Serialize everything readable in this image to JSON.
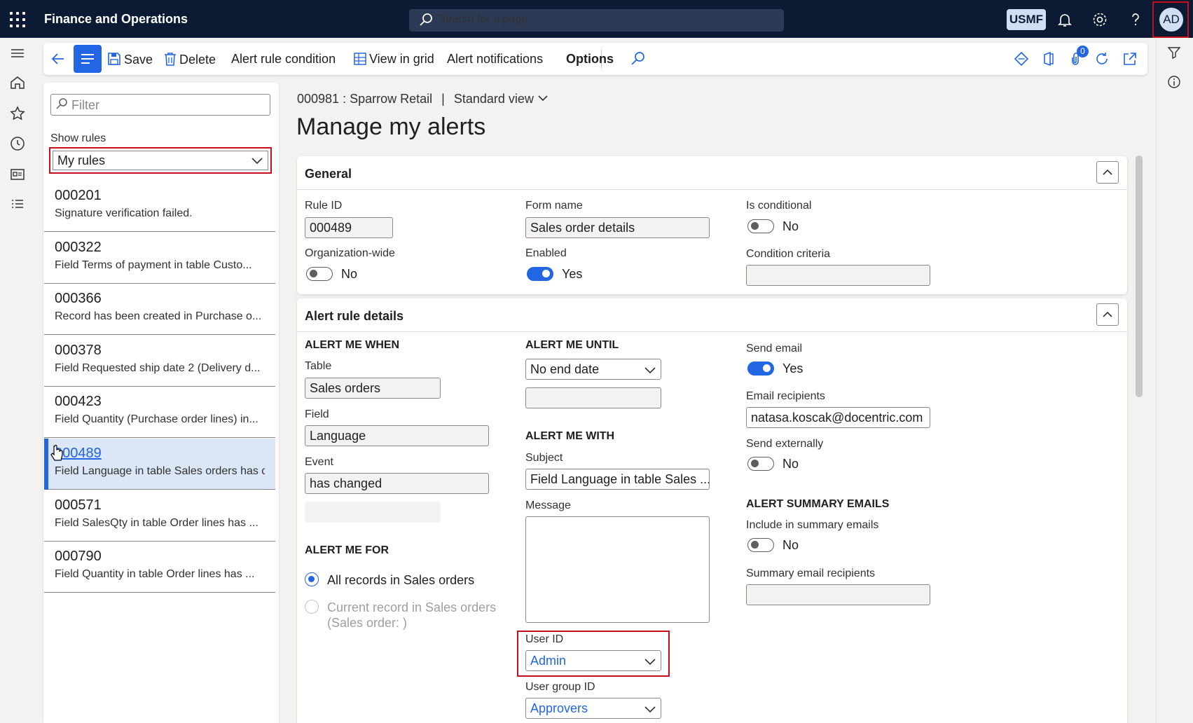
{
  "header": {
    "app_title": "Finance and Operations",
    "search_placeholder": "Search for a page",
    "company": "USMF",
    "avatar_initials": "AD"
  },
  "left_nav": [
    "menu-icon",
    "home-icon",
    "star-icon",
    "clock-icon",
    "workspace-icon",
    "list-icon"
  ],
  "action_pane": {
    "save": "Save",
    "delete": "Delete",
    "alert_rule_condition": "Alert rule condition",
    "view_in_grid": "View in grid",
    "alert_notifications": "Alert notifications",
    "options": "Options",
    "attachments_count": "0"
  },
  "list": {
    "filter_placeholder": "Filter",
    "show_rules_label": "Show rules",
    "show_rules_value": "My rules",
    "rules": [
      {
        "id": "000201",
        "desc": "Signature verification failed."
      },
      {
        "id": "000322",
        "desc": "Field Terms of payment in table Custo..."
      },
      {
        "id": "000366",
        "desc": "Record has been created in Purchase o..."
      },
      {
        "id": "000378",
        "desc": "Field Requested ship date 2 (Delivery d..."
      },
      {
        "id": "000423",
        "desc": "Field Quantity (Purchase order lines) in..."
      },
      {
        "id": "000489",
        "desc": "Field Language in table Sales orders has c"
      },
      {
        "id": "000571",
        "desc": "Field SalesQty in table Order lines has ..."
      },
      {
        "id": "000790",
        "desc": "Field Quantity in table Order lines has ..."
      }
    ]
  },
  "main": {
    "breadcrumb_record": "000981 : Sparrow Retail",
    "breadcrumb_sep": "|",
    "breadcrumb_view": "Standard view",
    "title": "Manage my alerts"
  },
  "general": {
    "header": "General",
    "rule_id_label": "Rule ID",
    "rule_id": "000489",
    "form_name_label": "Form name",
    "form_name": "Sales order details",
    "is_conditional_label": "Is conditional",
    "is_conditional": "No",
    "org_wide_label": "Organization-wide",
    "org_wide": "No",
    "enabled_label": "Enabled",
    "enabled": "Yes",
    "condition_criteria_label": "Condition criteria"
  },
  "details": {
    "header": "Alert rule details",
    "when_header": "ALERT ME WHEN",
    "table_label": "Table",
    "table": "Sales orders",
    "field_label": "Field",
    "field": "Language",
    "event_label": "Event",
    "event": "has changed",
    "for_header": "ALERT ME FOR",
    "for_all": "All records in Sales orders",
    "for_current_1": "Current record in Sales orders",
    "for_current_2": "(Sales order: )",
    "until_header": "ALERT ME UNTIL",
    "until_value": "No end date",
    "with_header": "ALERT ME WITH",
    "subject_label": "Subject",
    "subject": "Field Language in table Sales ...",
    "message_label": "Message",
    "user_id_label": "User ID",
    "user_id": "Admin",
    "user_group_label": "User group ID",
    "user_group": "Approvers",
    "send_email_label": "Send email",
    "send_email": "Yes",
    "email_recipients_label": "Email recipients",
    "email_recipients": "natasa.koscak@docentric.com",
    "send_externally_label": "Send externally",
    "send_externally": "No",
    "summary_header": "ALERT SUMMARY EMAILS",
    "include_summary_label": "Include in summary emails",
    "include_summary": "No",
    "summary_recipients_label": "Summary email recipients"
  }
}
